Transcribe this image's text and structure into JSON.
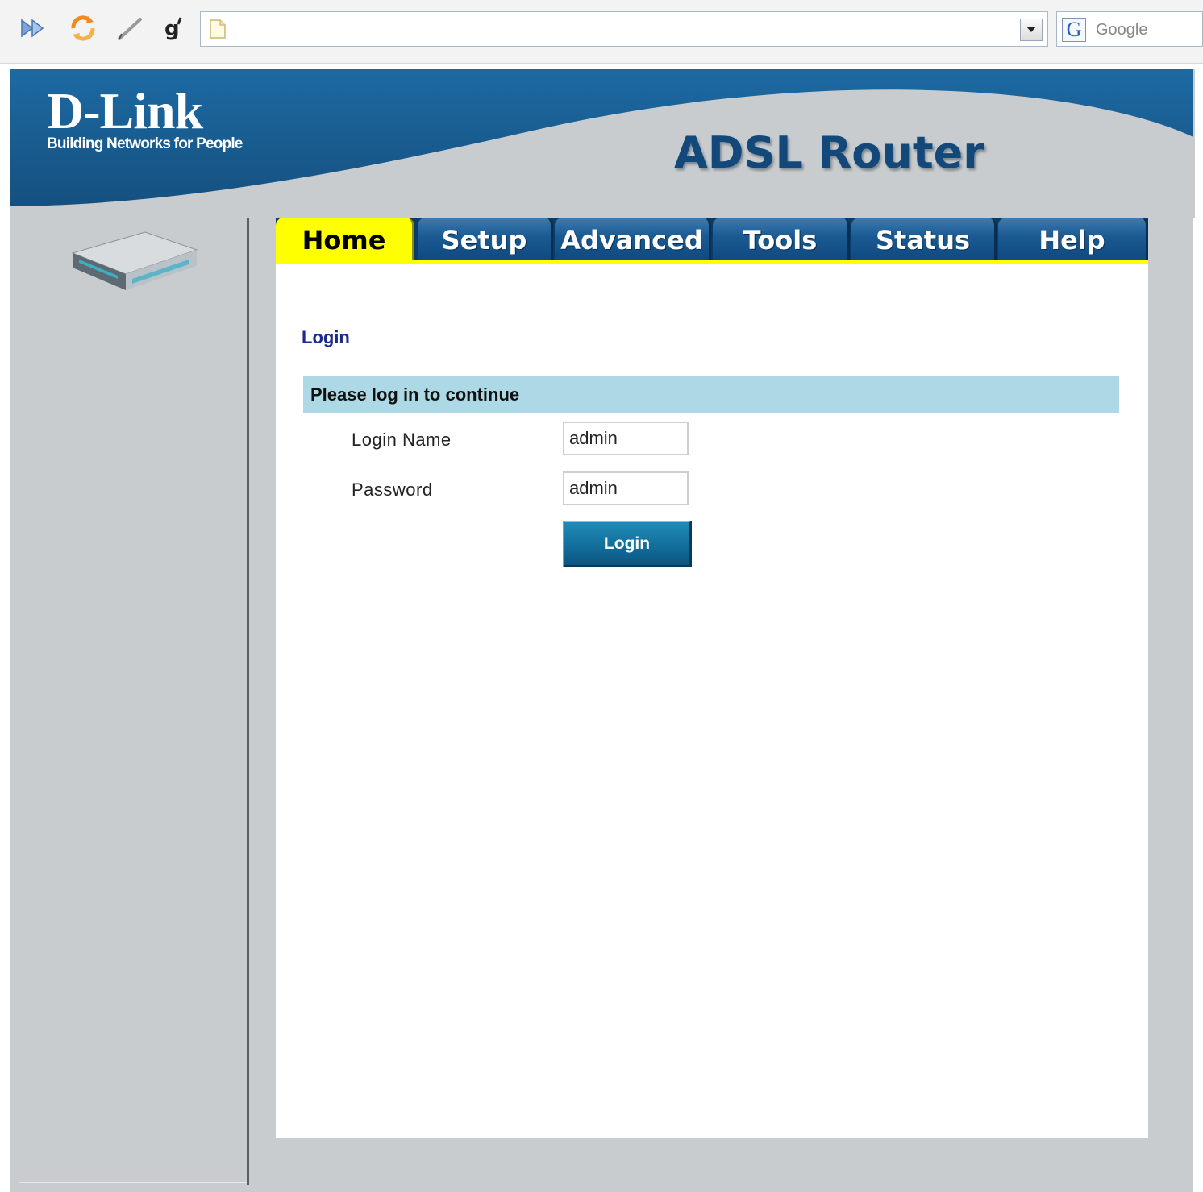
{
  "browser": {
    "address_value": "",
    "search_engine_label": "Google",
    "search_logo_letter": "G"
  },
  "header": {
    "brand_name": "D-Link",
    "brand_tagline": "Building Networks for People",
    "product_title": "ADSL Router"
  },
  "tabs": [
    {
      "label": "Home",
      "active": true
    },
    {
      "label": "Setup",
      "active": false
    },
    {
      "label": "Advanced",
      "active": false
    },
    {
      "label": "Tools",
      "active": false
    },
    {
      "label": "Status",
      "active": false
    },
    {
      "label": "Help",
      "active": false
    }
  ],
  "login": {
    "page_title": "Login",
    "section_header": "Please log in to continue",
    "login_name_label": "Login Name",
    "login_name_value": "admin",
    "password_label": "Password",
    "password_value": "admin",
    "submit_label": "Login"
  },
  "colors": {
    "header_blue": "#1c5f95",
    "tab_active": "#ffff00",
    "section_bar": "#add8e6",
    "frame_gray": "#c9cccf",
    "title_blue": "#1a2b8c"
  }
}
